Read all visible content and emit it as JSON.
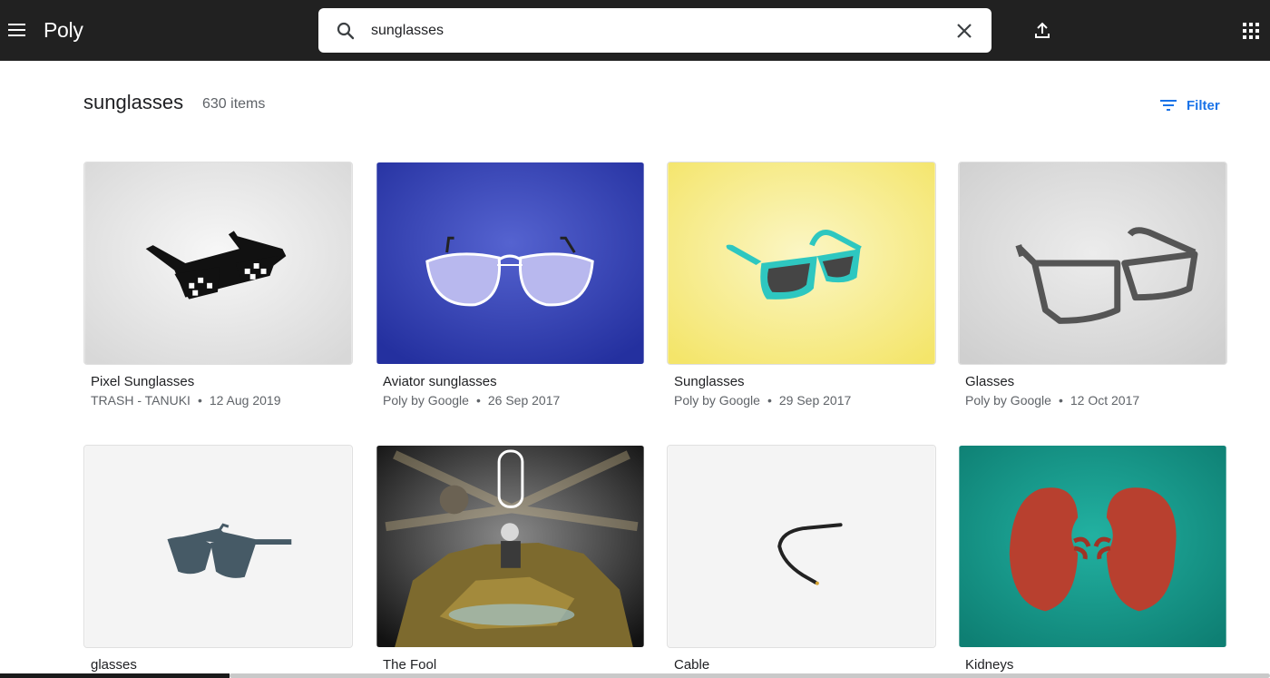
{
  "app": {
    "title": "Poly"
  },
  "search": {
    "value": "sunglasses",
    "placeholder": ""
  },
  "results": {
    "title": "sunglasses",
    "count": "630 items"
  },
  "filter": {
    "label": "Filter"
  },
  "accent_color": "#1a73e8",
  "cards": [
    {
      "title": "Pixel Sunglasses",
      "author": "TRASH - TANUKI",
      "date": "12 Aug 2019",
      "thumb_color": "#e8e8e8"
    },
    {
      "title": "Aviator sunglasses",
      "author": "Poly by Google",
      "date": "26 Sep 2017",
      "thumb_color": "#3446b8"
    },
    {
      "title": "Sunglasses",
      "author": "Poly by Google",
      "date": "29 Sep 2017",
      "thumb_color": "#f7ec8a"
    },
    {
      "title": "Glasses",
      "author": "Poly by Google",
      "date": "12 Oct 2017",
      "thumb_color": "#dcdcdc"
    },
    {
      "title": "glasses",
      "author": "",
      "date": "",
      "thumb_color": "#f4f4f4"
    },
    {
      "title": "The Fool",
      "author": "",
      "date": "",
      "thumb_color": "#2b2b2b"
    },
    {
      "title": "Cable",
      "author": "",
      "date": "",
      "thumb_color": "#f4f4f4"
    },
    {
      "title": "Kidneys",
      "author": "",
      "date": "",
      "thumb_color": "#17998a"
    }
  ],
  "icons": [
    "menu-icon",
    "search-icon",
    "close-icon",
    "upload-icon",
    "apps-grid-icon",
    "filter-icon"
  ]
}
